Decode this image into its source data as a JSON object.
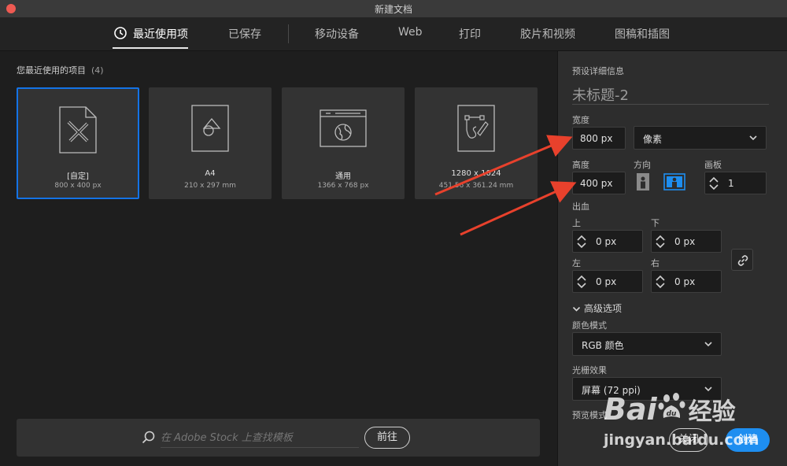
{
  "window": {
    "title": "新建文档"
  },
  "tabs": [
    {
      "label": "最近使用项",
      "active": true
    },
    {
      "label": "已保存"
    },
    {
      "label": "移动设备"
    },
    {
      "label": "Web"
    },
    {
      "label": "打印"
    },
    {
      "label": "胶片和视频"
    },
    {
      "label": "图稿和插图"
    }
  ],
  "recent": {
    "title": "您最近使用的项目",
    "count": "(4)",
    "items": [
      {
        "name": "[自定]",
        "dims": "800 x 400 px",
        "icon": "custom-document-icon",
        "selected": true
      },
      {
        "name": "A4",
        "dims": "210 x 297 mm",
        "icon": "print-document-icon"
      },
      {
        "name": "通用",
        "dims": "1366 x 768 px",
        "icon": "web-browser-icon"
      },
      {
        "name": "1280 x 1024",
        "dims": "451.56 x 361.24 mm",
        "icon": "illustration-document-icon"
      }
    ]
  },
  "search": {
    "placeholder": "在 Adobe Stock 上查找模板",
    "go_label": "前往"
  },
  "details": {
    "heading": "预设详细信息",
    "doc_name": "未标题-2",
    "width_label": "宽度",
    "width_value": "800 px",
    "unit": "像素",
    "height_label": "高度",
    "height_value": "400 px",
    "orientation_label": "方向",
    "artboard_label": "画板",
    "artboard_value": "1",
    "bleed_label": "出血",
    "bleed": {
      "top_label": "上",
      "top": "0 px",
      "bottom_label": "下",
      "bottom": "0 px",
      "left_label": "左",
      "left": "0 px",
      "right_label": "右",
      "right": "0 px"
    },
    "advanced_label": "高级选项",
    "color_mode_label": "颜色模式",
    "color_mode": "RGB 颜色",
    "raster_label": "光栅效果",
    "raster": "屏幕 (72 ppi)",
    "preview_label": "预览模式",
    "close_label": "关闭",
    "create_label": "创建"
  },
  "watermark": {
    "brand": "Bai",
    "brand_cn": "经验",
    "url": "jingyan.baidu.com"
  },
  "colors": {
    "accent": "#1473e6",
    "create": "#1e8ef0",
    "annotation": "#e8412c"
  }
}
